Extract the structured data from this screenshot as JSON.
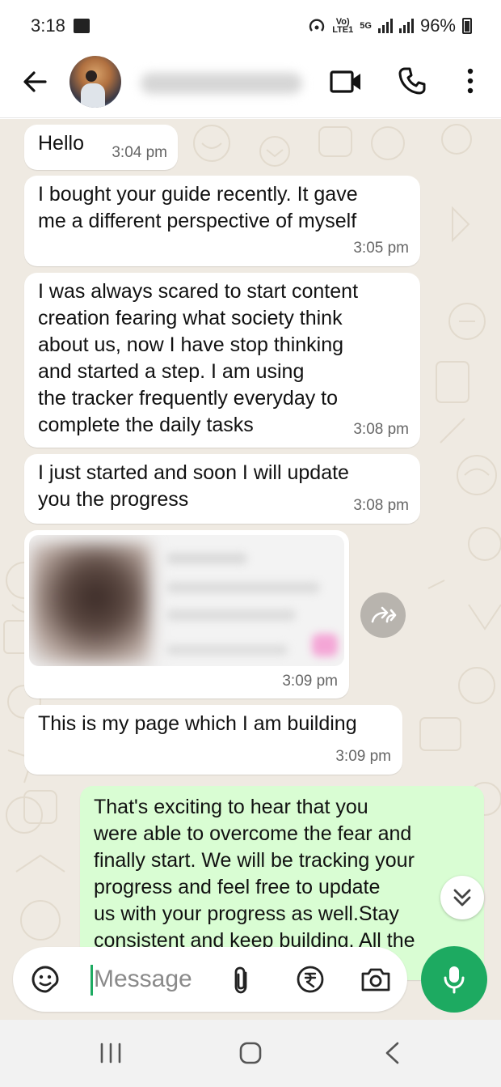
{
  "status_bar": {
    "time": "3:18",
    "volte_tag": "Vo)\nLTE1",
    "net_tag": "5G",
    "battery_percent": "96%"
  },
  "header": {
    "contact_name": "",
    "avatar": "avatar"
  },
  "messages": [
    {
      "text": "Hello",
      "time": "3:04 pm",
      "direction": "in"
    },
    {
      "text": "I bought your guide recently. It gave\nme a different perspective of myself",
      "time": "3:05 pm",
      "direction": "in"
    },
    {
      "text": "I was always scared to start content\ncreation fearing what society think\nabout us, now I have stop thinking\nand started a step. I am using\nthe tracker frequently everyday to\ncomplete the daily tasks",
      "time": "3:08 pm",
      "direction": "in"
    },
    {
      "text": "I just started and soon I will update\nyou the progress",
      "time": "3:08 pm",
      "direction": "in"
    },
    {
      "text": "",
      "time": "3:09 pm",
      "direction": "in",
      "type": "media-blurred"
    },
    {
      "text": "This is my page which I am building",
      "time": "3:09 pm",
      "direction": "in"
    },
    {
      "text": "That's exciting to hear that you\nwere able to overcome the fear and\nfinally start. We will be tracking your\nprogress and feel free to update\nus with your progress as well.Stay\nconsistent and keep building. All the",
      "time": "",
      "direction": "out"
    }
  ],
  "composer": {
    "placeholder": "Message"
  },
  "colors": {
    "chat_background": "#efeae2",
    "outgoing_bubble": "#d9fdd3",
    "incoming_bubble": "#ffffff",
    "accent_green": "#1daa61"
  },
  "icons": {
    "back": "arrow-left-icon",
    "video": "video-camera-icon",
    "call": "phone-icon",
    "menu": "more-vertical-icon",
    "forward": "forward-icon",
    "scroll_down": "double-chevron-down-icon",
    "emoji": "sticker-icon",
    "attach": "paperclip-icon",
    "payment": "rupee-icon",
    "camera": "camera-icon",
    "mic": "microphone-icon"
  }
}
